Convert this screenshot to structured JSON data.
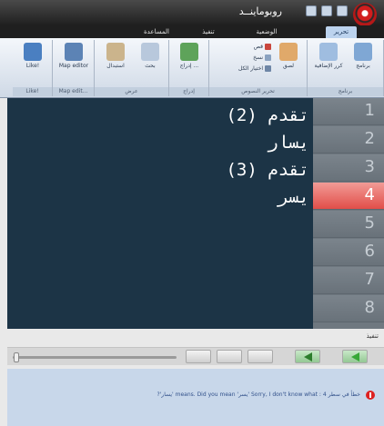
{
  "window": {
    "title": "روبوماينــد"
  },
  "tabs": [
    {
      "label": "تحرير",
      "active": true
    },
    {
      "label": "الوضعية",
      "active": false
    },
    {
      "label": "تنفيذ",
      "active": false
    },
    {
      "label": "المساعدة",
      "active": false
    }
  ],
  "ribbon": {
    "groups": [
      {
        "label": "برنامج"
      },
      {
        "label": "تحرير النصوص"
      },
      {
        "label": "إدراج"
      },
      {
        "label": "عرض"
      },
      {
        "label": "Map edit..."
      },
      {
        "label": "Like!"
      }
    ],
    "buttons": [
      {
        "label": "برنامج"
      },
      {
        "label": "كرر الإضافية"
      },
      {
        "label": "لصق"
      },
      {
        "label": "إدراج ..."
      },
      {
        "label": "بحث"
      },
      {
        "label": "استبدال"
      },
      {
        "label": "Map editor"
      },
      {
        "label": "Like!"
      }
    ],
    "small_buttons": [
      {
        "label": "قص"
      },
      {
        "label": "نسخ"
      },
      {
        "label": "اختيار الكل"
      }
    ]
  },
  "editor": {
    "lines": [
      {
        "text": "تقدم (2)"
      },
      {
        "text": "يسار"
      },
      {
        "text": "تقدم (3)"
      },
      {
        "text": "يسر"
      }
    ],
    "line_numbers": [
      "1",
      "2",
      "3",
      "4",
      "5",
      "6",
      "7",
      "8"
    ],
    "highlighted_line": "4"
  },
  "status": {
    "label": "تنفيذ"
  },
  "playback": {
    "slider_value": 0.02
  },
  "message": {
    "text": "خطأ في سطر 4 : Sorry, I don't know what 'يسر' means. Did you mean 'يسار'?"
  },
  "colors": {
    "editor_bg": "#1c3446",
    "gutter": "#6f7880",
    "highlight": "#e14e49",
    "message_bg": "#c8d7ea",
    "ribbon_tab": "#bcd3ee"
  }
}
